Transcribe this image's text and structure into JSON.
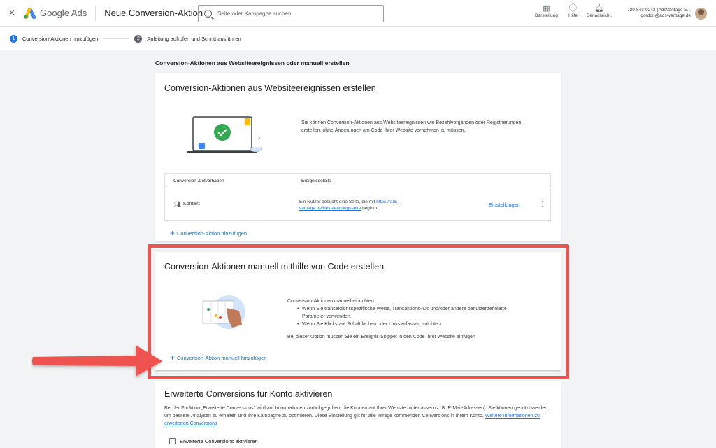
{
  "topbar": {
    "close_icon": "×",
    "logo_text": "Google Ads",
    "title": "Neue Conversion-Aktion",
    "search_placeholder": "Seite oder Kampagne suchen",
    "tools": [
      {
        "label": "Darstellung",
        "icon": "appearance-icon"
      },
      {
        "label": "Hilfe",
        "icon": "help-icon"
      },
      {
        "label": "Benachricht.",
        "icon": "bell-icon"
      }
    ],
    "account_line1": "729-843-9242 (AdsVantage E...",
    "account_line2": "gordon@ads-vantage.de"
  },
  "steps": [
    {
      "num": "1",
      "label": "Conversion-Aktionen hinzufügen",
      "active": true
    },
    {
      "num": "2",
      "label": "Anleitung aufrufen und Schritt ausführen",
      "active": false
    }
  ],
  "section_header": "Conversion-Aktionen aus Websiteereignissen oder manuell erstellen",
  "website_card": {
    "title": "Conversion-Aktionen aus Websiteereignissen erstellen",
    "description": "Sie können Conversion-Aktionen aus Websiteereignissen wie Bezahlvorgängen oder Registrierungen erstellen, ohne Änderungen am Code Ihrer Website vornehmen zu müssen.",
    "table": {
      "col1": "Conversion-Zielvorhaben",
      "col2": "Ereignisdetails",
      "row": {
        "goal": "Kontakt",
        "details_prefix": "Ein Nutzer besucht eine Seite, die mit ",
        "details_link_1": "https://ads-",
        "details_link_2": "vantage.de/bestaetigungsseite",
        "details_suffix": " beginnt",
        "settings": "Einstellungen",
        "more": "⋮"
      }
    },
    "add_link": "Conversion-Aktion hinzufügen"
  },
  "manual_card": {
    "title": "Conversion-Aktionen manuell mithilfe von Code erstellen",
    "intro": "Conversion-Aktionen manuell einrichten:",
    "bullet1_line1": "Wenn Sie transaktionsspezifische Werte, Transaktions-IDs und/oder andere benutzerdefinierte",
    "bullet1_line2": "Parameter verwenden.",
    "bullet2": "Wenn Sie Klicks auf Schaltflächen oder Links erfassen möchten.",
    "note": "Bei dieser Option müssen Sie ein Ereignis-Snippet in den Code Ihrer Website einfügen",
    "add_link": "Conversion-Aktion manuell hinzufügen"
  },
  "enhanced_card": {
    "title": "Erweiterte Conversions für Konto aktivieren",
    "description": "Bei der Funktion „Erweiterte Conversions\" wird auf Informationen zurückgegriffen, die Kunden auf Ihrer Website hinterlassen (z. B. E-Mail-Adressen). Sie können genutzt werden, um bessere Analysen zu erhalten und Ihre Kampagne zu optimieren. Diese Einstellung gilt für alle infrage kommenden Conversions in Ihrem Konto.",
    "more_link": "Weitere Informationen zu erweiterten Conversions",
    "checkbox_label": "Erweiterte Conversions aktivieren"
  },
  "colors": {
    "accent": "#1a73e8",
    "highlight": "#ef5350",
    "success": "#34a853"
  }
}
